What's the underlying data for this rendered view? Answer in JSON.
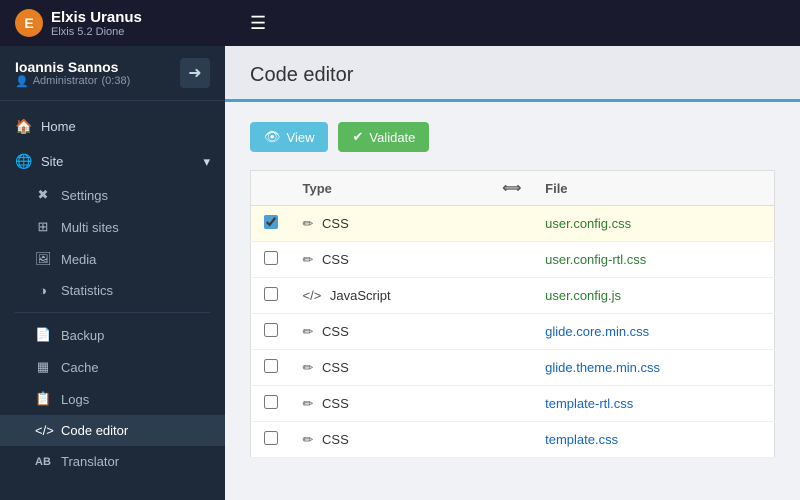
{
  "topbar": {
    "app_name": "Elxis Uranus",
    "app_version": "Elxis 5.2 Dione",
    "logo_letter": "E"
  },
  "sidebar": {
    "user_name": "Ioannis Sannos",
    "user_role": "Administrator",
    "user_session": "(0:38)",
    "nav_items": [
      {
        "id": "home",
        "label": "Home",
        "icon": "🏠"
      },
      {
        "id": "site",
        "label": "Site",
        "icon": "🌐",
        "has_arrow": true
      }
    ],
    "sub_items": [
      {
        "id": "settings",
        "label": "Settings",
        "icon": "⚙️"
      },
      {
        "id": "multi-sites",
        "label": "Multi sites",
        "icon": "🔲"
      },
      {
        "id": "media",
        "label": "Media",
        "icon": "🖼️"
      },
      {
        "id": "statistics",
        "label": "Statistics",
        "icon": "📊"
      }
    ],
    "nav_items2": [
      {
        "id": "backup",
        "label": "Backup",
        "icon": "💾"
      },
      {
        "id": "cache",
        "label": "Cache",
        "icon": "▦"
      },
      {
        "id": "logs",
        "label": "Logs",
        "icon": "📋"
      },
      {
        "id": "code-editor",
        "label": "Code editor",
        "icon": "⟨/⟩",
        "active": true
      },
      {
        "id": "translator",
        "label": "Translator",
        "icon": "AB"
      }
    ]
  },
  "content": {
    "title": "Code editor",
    "buttons": {
      "view": "View",
      "validate": "Validate"
    },
    "table": {
      "col_checkbox": "",
      "col_type": "Type",
      "col_arrows": "⟺",
      "col_file": "File",
      "rows": [
        {
          "id": 1,
          "type": "CSS",
          "type_icon": "✏️",
          "file": "user.config.css",
          "file_color": "green",
          "selected": true
        },
        {
          "id": 2,
          "type": "CSS",
          "type_icon": "✏️",
          "file": "user.config-rtl.css",
          "file_color": "green",
          "selected": false
        },
        {
          "id": 3,
          "type": "JavaScript",
          "type_icon": "⟨/⟩",
          "file": "user.config.js",
          "file_color": "green",
          "selected": false
        },
        {
          "id": 4,
          "type": "CSS",
          "type_icon": "✏️",
          "file": "glide.core.min.css",
          "file_color": "blue",
          "selected": false
        },
        {
          "id": 5,
          "type": "CSS",
          "type_icon": "✏️",
          "file": "glide.theme.min.css",
          "file_color": "blue",
          "selected": false
        },
        {
          "id": 6,
          "type": "CSS",
          "type_icon": "✏️",
          "file": "template-rtl.css",
          "file_color": "blue",
          "selected": false
        },
        {
          "id": 7,
          "type": "CSS",
          "type_icon": "✏️",
          "file": "template.css",
          "file_color": "blue",
          "selected": false
        }
      ]
    }
  }
}
